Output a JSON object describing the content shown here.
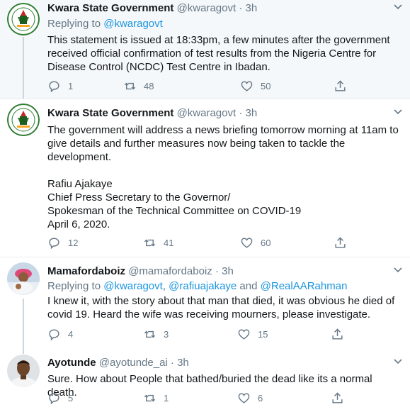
{
  "tweets": [
    {
      "name": "Kwara State Government",
      "handle": "@kwaragovt",
      "time": "3h",
      "dot": "·",
      "reply_prefix": "Replying to ",
      "reply_mention": "@kwaragovt",
      "text": "This statement is issued at 18:33pm, a few minutes after the government received official confirmation of test results from the Nigeria Centre for Disease Control (NCDC) Test Centre in Ibadan.",
      "replies": "1",
      "retweets": "48",
      "likes": "50"
    },
    {
      "name": "Kwara State Government",
      "handle": "@kwaragovt",
      "time": "3h",
      "dot": "·",
      "text": "The government will address a news briefing tomorrow morning at 11am to give details and further measures now being taken to tackle the development.\n\nRafiu Ajakaye\nChief Press Secretary to the Governor/\nSpokesman of the Technical Committee on COVID-19\nApril 6, 2020.",
      "replies": "12",
      "retweets": "41",
      "likes": "60"
    },
    {
      "name": "Mamafordaboiz",
      "handle": "@mamafordaboiz",
      "time": "3h",
      "dot": "·",
      "reply_prefix": "Replying to ",
      "reply_mention_1": "@kwaragovt",
      "reply_sep_1": ", ",
      "reply_mention_2": "@rafiuajakaye",
      "reply_sep_2": " and ",
      "reply_mention_3": "@RealAARahman",
      "text": "I knew it, with the story about that man that died, it was obvious he died of covid 19. Heard the wife was receiving mourners, please investigate.",
      "replies": "4",
      "retweets": "3",
      "likes": "15"
    },
    {
      "name": "Ayotunde",
      "handle": "@ayotunde_ai",
      "time": "3h",
      "dot": "·",
      "text": "Sure. How about People that bathed/buried the dead like its a normal death.",
      "replies": "5",
      "retweets": "1",
      "likes": "6"
    }
  ],
  "icons": {
    "reply": "reply-icon",
    "retweet": "retweet-icon",
    "like": "heart-icon",
    "share": "share-icon",
    "caret": "chevron-down-icon"
  },
  "colors": {
    "highlight_bg": "#f5f8fa",
    "muted": "#657786",
    "link": "#1b95e0",
    "divider": "#e6ecf0"
  }
}
